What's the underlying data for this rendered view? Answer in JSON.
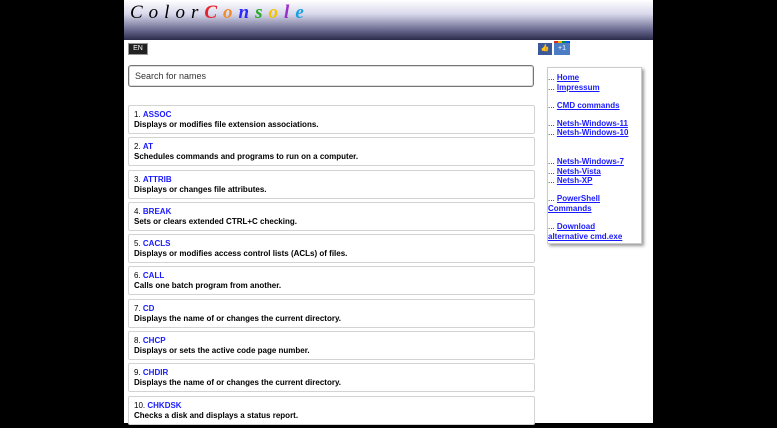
{
  "header": {
    "logo_word1": "Color",
    "logo_word2_letters": [
      {
        "ch": "C",
        "color": "#e3262b"
      },
      {
        "ch": "o",
        "color": "#f28c28"
      },
      {
        "ch": "n",
        "color": "#2a2aff"
      },
      {
        "ch": "s",
        "color": "#22aa22"
      },
      {
        "ch": "o",
        "color": "#f2c400"
      },
      {
        "ch": "l",
        "color": "#9b30c8"
      },
      {
        "ch": "e",
        "color": "#1aa0e0"
      }
    ]
  },
  "lang_flag": {
    "icon": "uk-flag-icon",
    "label": "EN"
  },
  "search": {
    "placeholder": "Search for names"
  },
  "commands": [
    {
      "num": "1.",
      "name": "ASSOC",
      "desc": "Displays or modifies file extension associations."
    },
    {
      "num": "2.",
      "name": "AT",
      "desc": "Schedules commands and programs to run on a computer."
    },
    {
      "num": "3.",
      "name": "ATTRIB",
      "desc": "Displays or changes file attributes."
    },
    {
      "num": "4.",
      "name": "BREAK",
      "desc": "Sets or clears extended CTRL+C checking."
    },
    {
      "num": "5.",
      "name": "CACLS",
      "desc": "Displays or modifies access control lists (ACLs) of files."
    },
    {
      "num": "6.",
      "name": "CALL",
      "desc": "Calls one batch program from another."
    },
    {
      "num": "7.",
      "name": "CD",
      "desc": "Displays the name of or changes the current directory."
    },
    {
      "num": "8.",
      "name": "CHCP",
      "desc": "Displays or sets the active code page number."
    },
    {
      "num": "9.",
      "name": "CHDIR",
      "desc": "Displays the name of or changes the current directory."
    },
    {
      "num": "10.",
      "name": "CHKDSK",
      "desc": "Checks a disk and displays a status report."
    }
  ],
  "social": {
    "like_icon": "thumbs-up-icon",
    "like_label": "👍",
    "gplus_label": "+1"
  },
  "sidebar": {
    "home": "Home",
    "impressum": "Impressum",
    "cmd_commands": "CMD commands",
    "netsh_win11": "Netsh-Windows-11",
    "netsh_win10": "Netsh-Windows-10",
    "netsh_win7": "Netsh-Windows-7",
    "netsh_vista": "Netsh-Vista",
    "netsh_xp": "Netsh-XP",
    "powershell_1": "PowerShell",
    "powershell_2": "Commands",
    "download": "Download",
    "alt_cmd": "alternative cmd.exe",
    "prefix": "..."
  }
}
